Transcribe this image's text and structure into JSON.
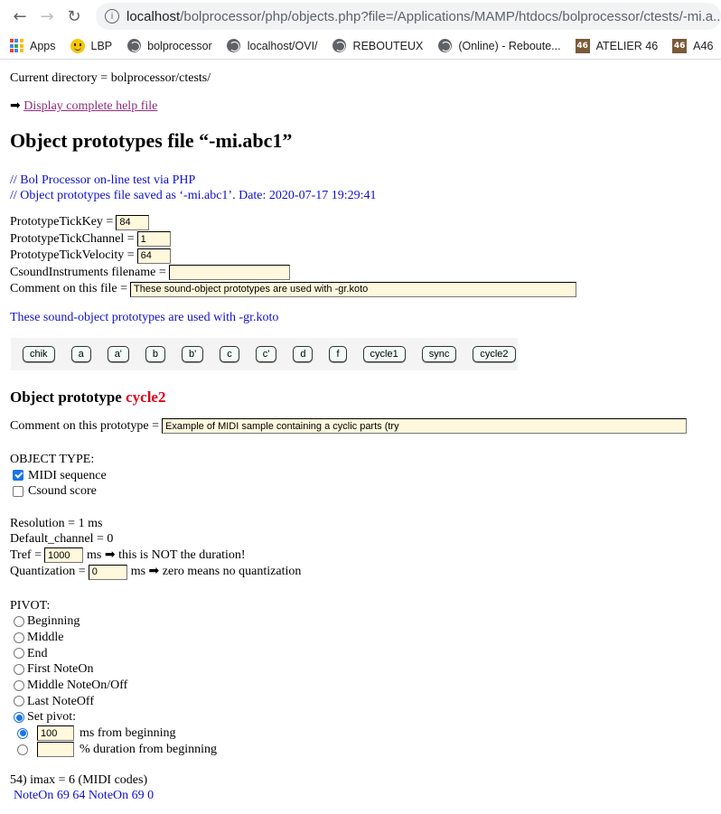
{
  "browser": {
    "url_host": "localhost",
    "url_rest": "/bolprocessor/php/objects.php?file=/Applications/MAMP/htdocs/bolprocessor/ctests/-mi.a..."
  },
  "bookmarks": [
    {
      "label": "Apps",
      "icon": "apps-grid-icon"
    },
    {
      "label": "LBP",
      "icon": "smiley-icon"
    },
    {
      "label": "bolprocessor",
      "icon": "globe-icon"
    },
    {
      "label": "localhost/OVI/",
      "icon": "globe-icon"
    },
    {
      "label": "REBOUTEUX",
      "icon": "globe-icon"
    },
    {
      "label": "(Online) - Reboute...",
      "icon": "globe-icon"
    },
    {
      "label": "ATELIER 46",
      "icon": "atelier-icon"
    },
    {
      "label": "A46",
      "icon": "atelier-icon"
    }
  ],
  "atelier_badge": "46",
  "page": {
    "current_directory": "Current directory = bolprocessor/ctests/",
    "help_arrow": "➡",
    "help_link": "Display complete help file",
    "title": "Object prototypes file “-mi.abc1”",
    "comment_lines": [
      "// Bol Processor on-line test via PHP",
      "// Object prototypes file saved as ‘-mi.abc1’. Date: 2020-07-17 19:29:41"
    ],
    "fields": {
      "tick_key_label": "PrototypeTickKey =",
      "tick_key_value": "84",
      "tick_channel_label": "PrototypeTickChannel =",
      "tick_channel_value": "1",
      "tick_velocity_label": "PrototypeTickVelocity =",
      "tick_velocity_value": "64",
      "csound_label": "CsoundInstruments filename =",
      "csound_value": "",
      "file_comment_label": "Comment on this file =",
      "file_comment_value": "These sound-object prototypes are used with -gr.koto"
    },
    "file_description": "These sound-object prototypes are used with -gr.koto",
    "prototype_buttons": [
      "chik",
      "a",
      "a'",
      "b",
      "b'",
      "c",
      "c'",
      "d",
      "f",
      "cycle1",
      "sync",
      "cycle2"
    ],
    "prototype": {
      "heading_prefix": "Object prototype",
      "name": "cycle2",
      "comment_label": "Comment on this prototype =",
      "comment_value": "Example of MIDI sample containing a cyclic parts (try",
      "object_type_label": "OBJECT TYPE:",
      "midi_sequence_label": "MIDI sequence",
      "midi_sequence_checked": true,
      "csound_score_label": "Csound score",
      "csound_score_checked": false,
      "resolution": "Resolution = 1 ms",
      "default_channel": "Default_channel = 0",
      "tref_label": "Tref =",
      "tref_value": "1000",
      "tref_note": "ms ➡ this is NOT the duration!",
      "quant_label": "Quantization =",
      "quant_value": "0",
      "quant_note": "ms ➡ zero means no quantization",
      "pivot_label": "PIVOT:",
      "pivot_options": [
        "Beginning",
        "Middle",
        "End",
        "First NoteOn",
        "Middle NoteOn/Off",
        "Last NoteOff",
        "Set pivot:"
      ],
      "pivot_selected": "Set pivot:",
      "set_ms_value": "100",
      "set_ms_label": "ms from beginning",
      "set_pct_value": "",
      "set_pct_label": "% duration from beginning",
      "imax_line": "54) imax = 6 (MIDI codes)",
      "midi_codes": "NoteOn 69 64  NoteOn 69 0"
    }
  }
}
